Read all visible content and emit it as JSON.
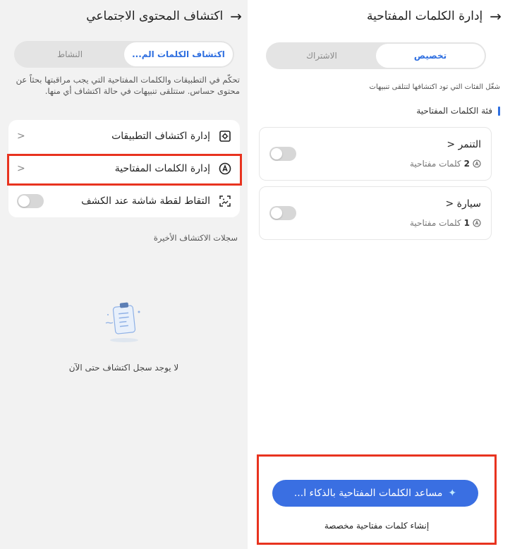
{
  "left": {
    "title": "اكتشاف المحتوى الاجتماعي",
    "tabs": [
      "اكتشاف الكلمات الم...",
      "النشاط"
    ],
    "description": "تحكّم في التطبيقات والكلمات المفتاحية التي يجب مراقبتها بحثاً عن محتوى حساس. ستتلقى تنبيهات في حالة اكتشاف أي منها.",
    "menu": [
      {
        "label": "إدارة اكتشاف التطبيقات",
        "icon": "app-scan-icon"
      },
      {
        "label": "إدارة الكلمات المفتاحية",
        "icon": "keyword-icon"
      },
      {
        "label": "التقاط لقطة شاشة عند الكشف",
        "icon": "screenshot-icon",
        "toggle": false
      }
    ],
    "recent_title": "سجلات الاكتشاف الأخيرة",
    "empty_text": "لا يوجد سجل اكتشاف حتى الآن"
  },
  "right": {
    "title": "إدارة الكلمات المفتاحية",
    "tabs": [
      "تخصيص",
      "الاشتراك"
    ],
    "description": "شغّل الفئات التي تود اكتشافها لتتلقى تنبيهات",
    "category_title": "فئة الكلمات المفتاحية",
    "categories": [
      {
        "name": "التنمر",
        "count": "2",
        "count_label": "كلمات مفتاحية",
        "enabled": false
      },
      {
        "name": "سيارة",
        "count": "1",
        "count_label": "كلمات مفتاحية",
        "enabled": false
      }
    ],
    "ai_button": "مساعد الكلمات المفتاحية بالذكاء ا...",
    "custom_link": "إنشاء كلمات مفتاحية مخصصة"
  },
  "colors": {
    "accent": "#2f6fe0",
    "highlight": "#e8331f",
    "ai_button": "#3a6fe2"
  }
}
